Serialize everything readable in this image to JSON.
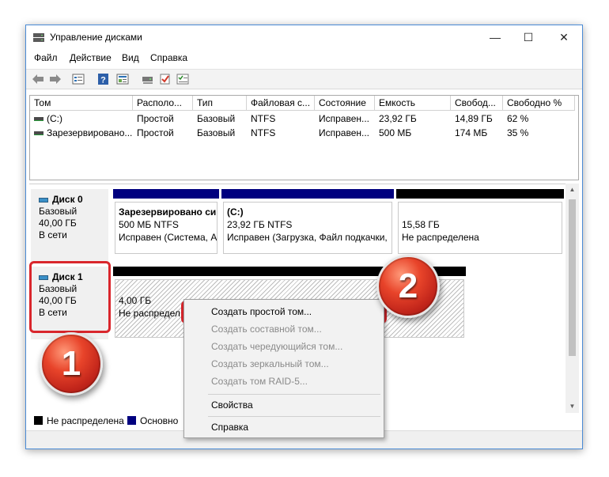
{
  "window": {
    "title": "Управление дисками",
    "controls": {
      "minimize": "—",
      "maximize": "☐",
      "close": "✕"
    }
  },
  "menu": [
    "Файл",
    "Действие",
    "Вид",
    "Справка"
  ],
  "toolbar": [
    "back-icon",
    "forward-icon",
    "list-view-icon",
    "help-icon",
    "properties-icon",
    "disk-icon",
    "check-icon",
    "checklist-icon"
  ],
  "table": {
    "headers": [
      "Том",
      "Располо...",
      "Тип",
      "Файловая с...",
      "Состояние",
      "Емкость",
      "Свобод...",
      "Свободно %"
    ],
    "rows": [
      [
        "(C:)",
        "Простой",
        "Базовый",
        "NTFS",
        "Исправен...",
        "23,92 ГБ",
        "14,89 ГБ",
        "62 %"
      ],
      [
        "Зарезервировано...",
        "Простой",
        "Базовый",
        "NTFS",
        "Исправен...",
        "500 МБ",
        "174 МБ",
        "35 %"
      ]
    ]
  },
  "disks": [
    {
      "name": "Диск 0",
      "type": "Базовый",
      "size": "40,00 ГБ",
      "status": "В сети",
      "partitions": [
        {
          "title": "Зарезервировано си",
          "line1": "500 МБ NTFS",
          "line2": "Исправен (Система, А",
          "kind": "primary"
        },
        {
          "title": "(C:)",
          "line1": "23,92 ГБ NTFS",
          "line2": "Исправен (Загрузка, Файл подкачки,",
          "kind": "primary"
        },
        {
          "title": "",
          "line1": "15,58 ГБ",
          "line2": "Не распределена",
          "kind": "unallocated"
        }
      ]
    },
    {
      "name": "Диск 1",
      "type": "Базовый",
      "size": "40,00 ГБ",
      "status": "В сети",
      "partitions": [
        {
          "title": "",
          "line1": "4,00 ГБ",
          "line2": "Не распредел",
          "kind": "unallocated"
        }
      ]
    }
  ],
  "legend": [
    {
      "label": "Не распределена",
      "color": "#000000"
    },
    {
      "label": "Основно",
      "color": "#00007f"
    }
  ],
  "context_menu": [
    {
      "label": "Создать простой том...",
      "enabled": true
    },
    {
      "label": "Создать составной том...",
      "enabled": false
    },
    {
      "label": "Создать чередующийся том...",
      "enabled": false
    },
    {
      "label": "Создать зеркальный том...",
      "enabled": false
    },
    {
      "label": "Создать том RAID-5...",
      "enabled": false
    },
    {
      "label": "Свойства",
      "enabled": true
    },
    {
      "label": "Справка",
      "enabled": true
    }
  ],
  "annotations": {
    "step1": "1",
    "step2": "2",
    "highlight_color": "#d9262c"
  },
  "colors": {
    "primary_bar": "#00007f",
    "unallocated_bar": "#000000",
    "window_border": "#4a8bd6"
  }
}
